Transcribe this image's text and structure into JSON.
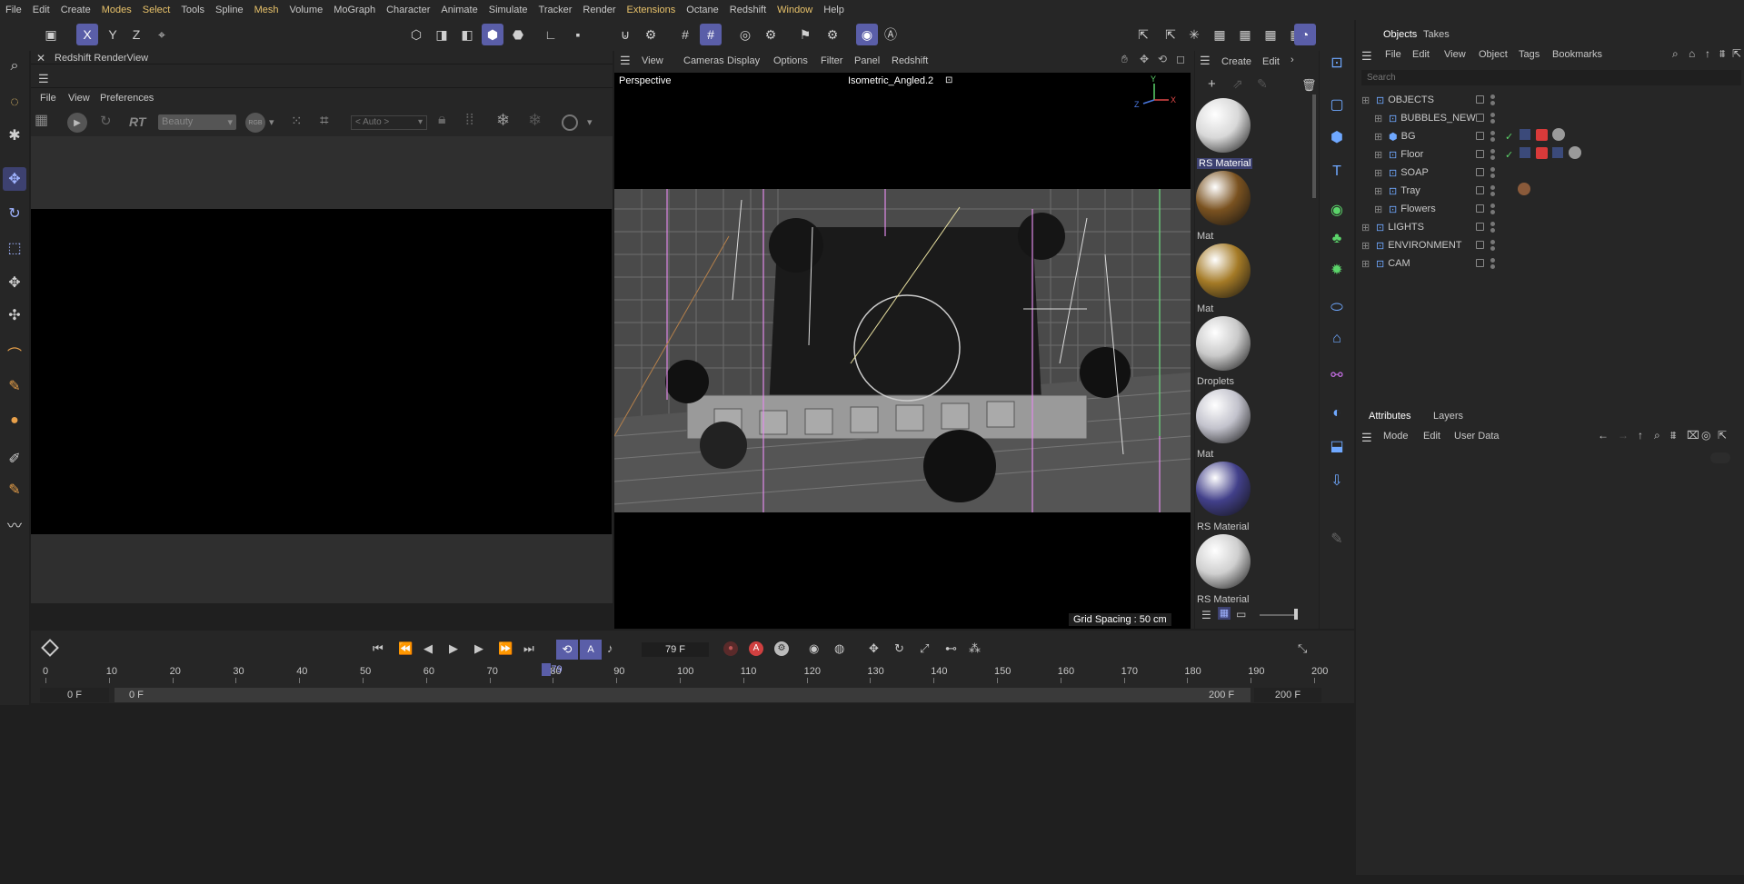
{
  "menu": [
    "File",
    "Edit",
    "Create",
    "Modes",
    "Select",
    "Tools",
    "Spline",
    "Mesh",
    "Volume",
    "MoGraph",
    "Character",
    "Animate",
    "Simulate",
    "Tracker",
    "Render",
    "Extensions",
    "Octane",
    "Redshift",
    "Window",
    "Help"
  ],
  "menu_highlight": [
    "Modes",
    "Select",
    "Mesh",
    "Extensions",
    "Window"
  ],
  "renderview": {
    "title": "Redshift RenderView",
    "menu": [
      "File",
      "View",
      "Preferences"
    ],
    "aov_select": "Beauty",
    "rt_label": "RT",
    "rgb_label": "RGB",
    "auto_select": "< Auto >"
  },
  "viewport": {
    "menu": [
      "View",
      "Cameras",
      "Display",
      "Options",
      "Filter",
      "Panel",
      "Redshift"
    ],
    "label_left": "Perspective",
    "camera_name": "Isometric_Angled.2",
    "grid_spacing": "Grid Spacing : 50 cm"
  },
  "materials": {
    "menu": [
      "Create",
      "Edit"
    ],
    "items": [
      {
        "label": "RS Material",
        "color": "#d8d8d8"
      },
      {
        "label": "Mat",
        "color": "#7a5220"
      },
      {
        "label": "Mat",
        "color": "#a47a26"
      },
      {
        "label": "Droplets",
        "color": "#c9c9c9"
      },
      {
        "label": "Mat",
        "color": "#c2c2cc"
      },
      {
        "label": "RS Material",
        "color": "#42408a"
      },
      {
        "label": "RS Material",
        "color": "#cfcfcf"
      }
    ]
  },
  "objects_panel": {
    "tabs": [
      "Objects",
      "Takes"
    ],
    "menu": [
      "File",
      "Edit",
      "View",
      "Object",
      "Tags",
      "Bookmarks"
    ],
    "search_placeholder": "Search",
    "rows": [
      {
        "name": "OBJECTS",
        "indent": 0
      },
      {
        "name": "BUBBLES_NEW",
        "indent": 1
      },
      {
        "name": "BG",
        "indent": 1
      },
      {
        "name": "Floor",
        "indent": 1
      },
      {
        "name": "SOAP",
        "indent": 1
      },
      {
        "name": "Tray",
        "indent": 1
      },
      {
        "name": "Flowers",
        "indent": 1
      },
      {
        "name": "LIGHTS",
        "indent": 0
      },
      {
        "name": "ENVIRONMENT",
        "indent": 0
      },
      {
        "name": "CAM",
        "indent": 0
      }
    ]
  },
  "attributes_panel": {
    "tabs": [
      "Attributes",
      "Layers"
    ],
    "menu": [
      "Mode",
      "Edit",
      "User Data"
    ]
  },
  "timeline": {
    "current_frame": "79 F",
    "playhead_value": "79",
    "ruler": [
      "0",
      "10",
      "20",
      "30",
      "40",
      "50",
      "60",
      "70",
      "80",
      "90",
      "100",
      "110",
      "120",
      "130",
      "140",
      "150",
      "160",
      "170",
      "180",
      "190",
      "200"
    ],
    "start": "0 F",
    "range_start": "0 F",
    "range_end": "200 F",
    "end": "200 F"
  },
  "accent_color": "#5a5ea8"
}
